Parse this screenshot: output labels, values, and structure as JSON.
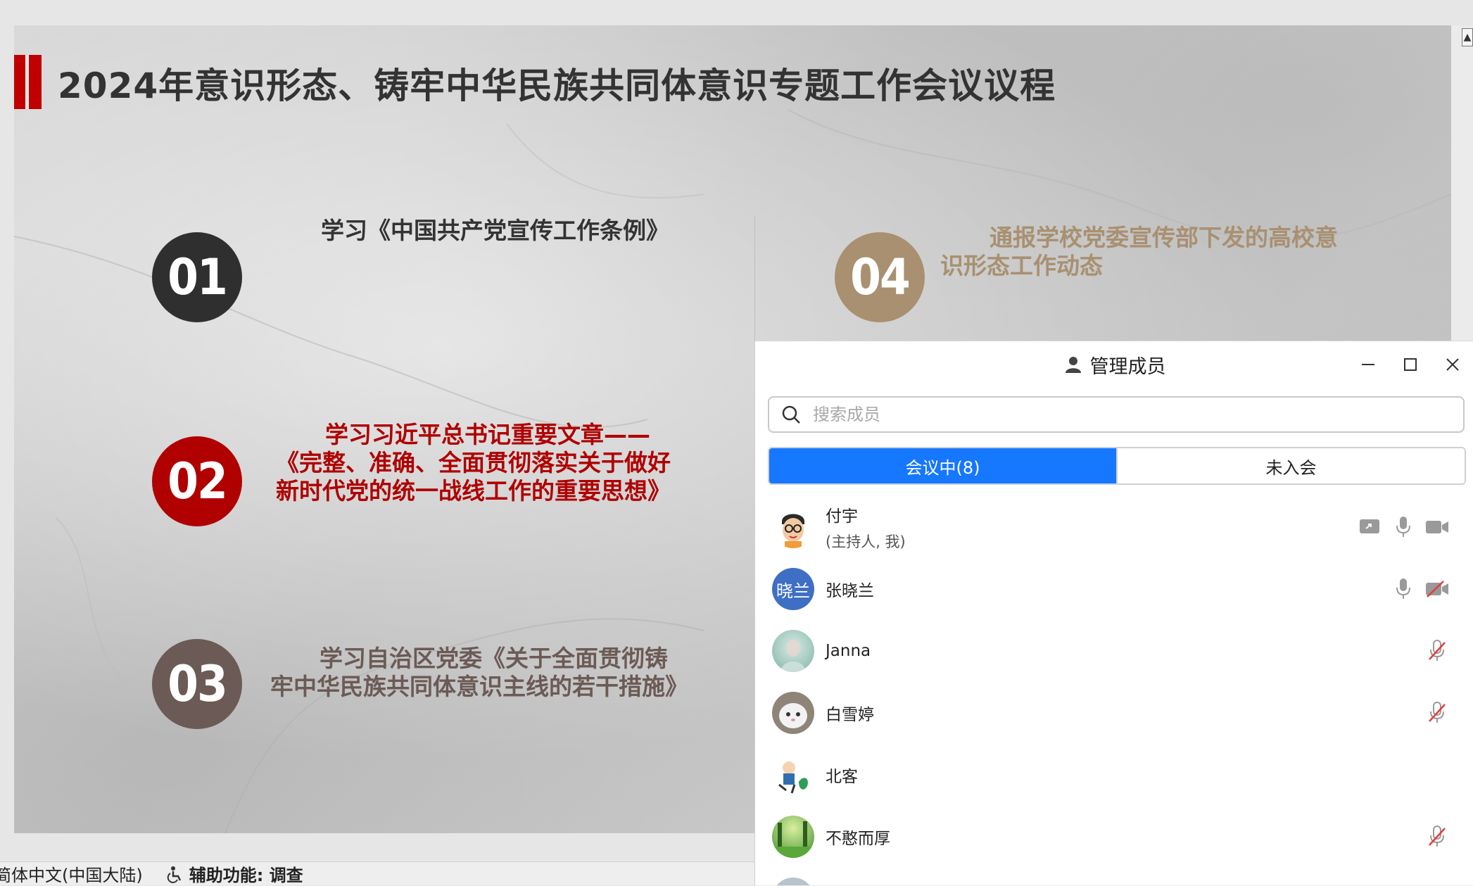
{
  "slide": {
    "title": "2024年意识形态、铸牢中华民族共同体意识专题工作会议议程",
    "items": [
      {
        "num": "01",
        "text": "学习《中国共产党宣传工作条例》"
      },
      {
        "num": "02",
        "text": "学习习近平总书记重要文章——《完整、准确、全面贯彻落实关于做好新时代党的统一战线工作的重要思想》"
      },
      {
        "num": "03",
        "text": "学习自治区党委《关于全面贯彻铸牢中华民族共同体意识主线的若干措施》"
      },
      {
        "num": "04",
        "text": "通报学校党委宣传部下发的高校意识形态工作动态"
      }
    ],
    "colors": {
      "accent_red": "#b00000",
      "dark": "#2f2f2f",
      "brown": "#6b5a55",
      "gold": "#a89070"
    }
  },
  "statusbar": {
    "language": "简体中文(中国大陆)",
    "accessibility": "辅助功能: 调查"
  },
  "panel": {
    "title": "管理成员",
    "title_icon": "members-icon",
    "search_placeholder": "搜索成员",
    "tabs": [
      {
        "label": "会议中(8)",
        "active": true
      },
      {
        "label": "未入会",
        "active": false
      }
    ],
    "accent": "#1677ff",
    "members": [
      {
        "name": "付宇",
        "sub": "(主持人, 我)",
        "icons": [
          "screen-share-icon",
          "mic-icon",
          "camera-icon"
        ]
      },
      {
        "name": "张晓兰",
        "avatar_text": "晓兰",
        "icons": [
          "mic-icon",
          "camera-off-icon"
        ]
      },
      {
        "name": "Janna",
        "icons": [
          "mic-off-icon"
        ]
      },
      {
        "name": "白雪婷",
        "icons": [
          "mic-off-icon"
        ]
      },
      {
        "name": "北客",
        "icons": []
      },
      {
        "name": "不憨而厚",
        "icons": [
          "mic-off-icon"
        ]
      }
    ]
  }
}
